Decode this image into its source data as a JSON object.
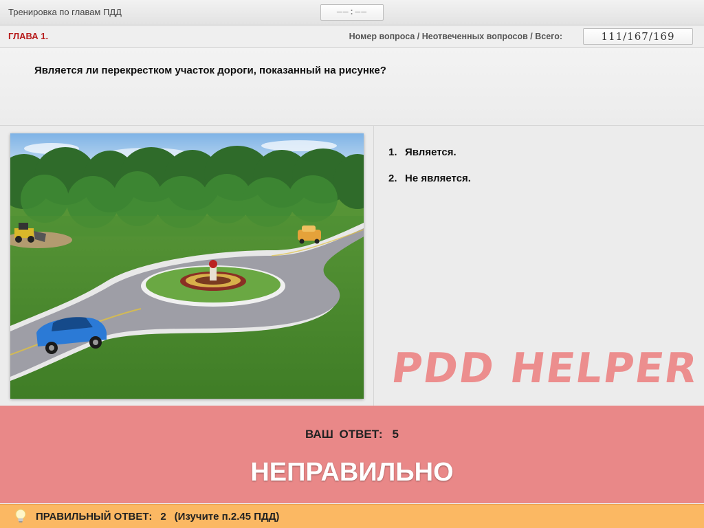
{
  "header": {
    "app_title": "Тренировка по главам ПДД",
    "timer": "——:——"
  },
  "chapter": {
    "label": "ГЛАВА 1.",
    "counter_label": "Номер вопроса / Неотвеченных вопросов / Всего:",
    "counter_value": "111/167/169"
  },
  "question": {
    "text": "Является ли перекрестком участок дороги, показанный на рисунке?",
    "image_icon": "roundabout-photo"
  },
  "answers": [
    {
      "number": "1.",
      "text": "Является."
    },
    {
      "number": "2.",
      "text": "Не является."
    }
  ],
  "watermark": "PDD HELPER",
  "result": {
    "your_answer_label": "ВАШ ОТВЕТ:",
    "your_answer_value": "5",
    "verdict": "НЕПРАВИЛЬНО"
  },
  "hint": {
    "icon": "lightbulb-icon",
    "label": "ПРАВИЛЬНЫЙ ОТВЕТ:",
    "value": "2",
    "reference": "(Изучите п.2.45 ПДД)"
  },
  "colors": {
    "result_bg": "#e98888",
    "hint_bg": "#fbb863",
    "chapter_red": "#b71c1c",
    "watermark": "#ec8a8a"
  }
}
